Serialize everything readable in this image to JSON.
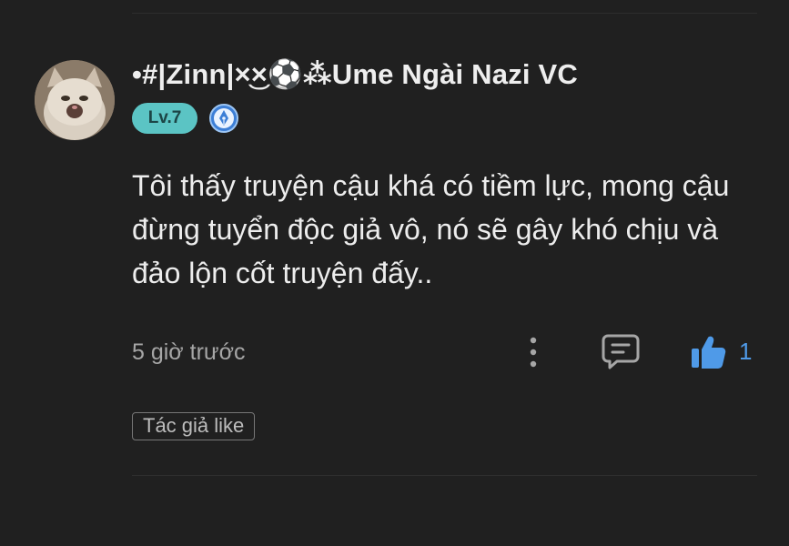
{
  "comment": {
    "username": "•#|Zinn|×͜×⚽⁂Ume Ngài Nazi VC",
    "level_badge": "Lv.7",
    "body": "Tôi thấy truyện cậu khá có tiềm lực, mong cậu đừng tuyển độc giả vô, nó sẽ gây khó chịu và đảo lộn cốt truyện đấy..",
    "timestamp": "5 giờ trước",
    "like_count": "1",
    "author_like_tag": "Tác giả like"
  },
  "icons": {
    "avatar": "cat-avatar-icon",
    "pen_badge": "pen-nib-icon",
    "more": "more-vertical-icon",
    "reply": "chat-bubble-icon",
    "like": "thumbs-up-icon"
  },
  "colors": {
    "background": "#202020",
    "level_badge": "#5bc4c4",
    "like_accent": "#4f9ae8",
    "pen_badge": "#3d7fd6"
  }
}
